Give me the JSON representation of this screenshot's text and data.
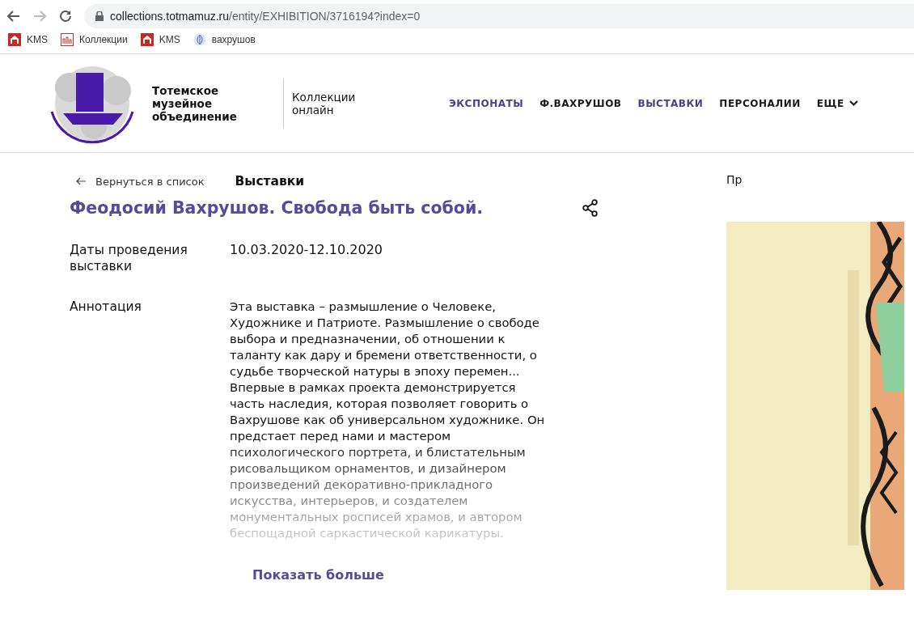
{
  "browser": {
    "url_host": "collections.totmamuz.ru",
    "url_path": "/entity/EXHIBITION/3716194?index=0",
    "bookmarks": [
      {
        "label": "KMS",
        "kind": "museum"
      },
      {
        "label": "Коллекции",
        "kind": "collection"
      },
      {
        "label": "KMS",
        "kind": "museum"
      },
      {
        "label": "вахрушов",
        "kind": "globe"
      }
    ]
  },
  "header": {
    "org_name": "Тотемское музейное объединение",
    "tagline": "Коллекции онлайн",
    "nav": [
      {
        "label": "ЭКСПОНАТЫ",
        "color": "#4b3f8c"
      },
      {
        "label": "Ф.ВАХРУШОВ",
        "color": "#1a1a1a"
      },
      {
        "label": "ВЫСТАВКИ",
        "color": "#4b3f8c"
      },
      {
        "label": "ПЕРСОНАЛИИ",
        "color": "#1a1a1a"
      },
      {
        "label": "ЕЩЕ",
        "color": "#1a1a1a"
      }
    ]
  },
  "breadcrumb": {
    "back": "Вернуться в список",
    "section": "Выставки",
    "cut_right": "Пр"
  },
  "exhibition": {
    "title": "Феодосий Вахрушов. Свобода быть собой.",
    "fields": [
      {
        "label": "Даты проведения выставки",
        "value": "10.03.2020-12.10.2020"
      }
    ],
    "annotation_label": "Аннотация",
    "annotation": [
      "Эта выставка – размышление о Человеке, Художнике и Патриоте. Размышление о свободе выбора и предназначении, об отношении к таланту как дару и бремени ответственности, о судьбе творческой натуры в эпоху перемен...",
      "Впервые в рамках проекта демонстрируется часть наследия, которая позволяет говорить о Вахрушове как об универсальном художнике. Он предстает перед нами и мастером психологического портрета, и блистательным рисовальщиком орнаментов, и дизайнером произведений декоративно-прикладного искусства, интерьеров, и создателем монументальных росписей храмов, и автором беспощадной саркастической карикатуры."
    ],
    "show_more": "Показать больше"
  }
}
